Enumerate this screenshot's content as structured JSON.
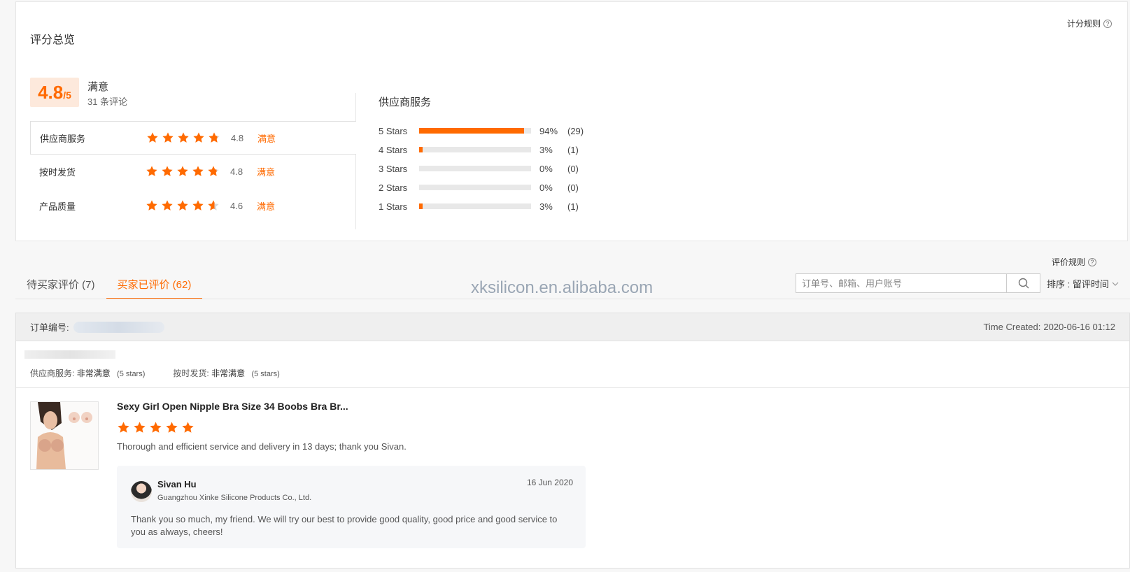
{
  "summary": {
    "title": "评分总览",
    "rules_link": "计分规则",
    "score": "4.8",
    "score_max": "/5",
    "score_label": "满意",
    "review_count": "31 条评论",
    "ratings": [
      {
        "name": "供应商服务",
        "score": "4.8",
        "grade": "满意",
        "stars_value": 4.8
      },
      {
        "name": "按时发货",
        "score": "4.8",
        "grade": "满意",
        "stars_value": 4.8
      },
      {
        "name": "产品质量",
        "score": "4.6",
        "grade": "满意",
        "stars_value": 4.6
      }
    ],
    "distribution_title": "供应商服务",
    "distribution": [
      {
        "label": "5 Stars",
        "pct": "94%",
        "count": "(29)",
        "value": 0.94
      },
      {
        "label": "4 Stars",
        "pct": "3%",
        "count": "(1)",
        "value": 0.03
      },
      {
        "label": "3 Stars",
        "pct": "0%",
        "count": "(0)",
        "value": 0
      },
      {
        "label": "2 Stars",
        "pct": "0%",
        "count": "(0)",
        "value": 0
      },
      {
        "label": "1 Stars",
        "pct": "3%",
        "count": "(1)",
        "value": 0.03
      }
    ]
  },
  "tabs": [
    {
      "label": "待买家评价 (7)"
    },
    {
      "label": "买家已评价 (62)"
    }
  ],
  "watermark": "xksilicon.en.alibaba.com",
  "review_rules": "评价规则",
  "search": {
    "placeholder": "订单号、邮箱、用户账号"
  },
  "sort": {
    "label": "排序 : 留评时间"
  },
  "review": {
    "order_label": "订单编号:",
    "time_label": "Time Created:",
    "time_value": "2020-06-16 01:12",
    "service_label": "供应商服务:",
    "service_value": "非常满意",
    "service_stars": "(5 stars)",
    "delivery_label": "按时发货:",
    "delivery_value": "非常满意",
    "delivery_stars": "(5 stars)",
    "product_title": "Sexy Girl Open Nipple Bra Size 34 Boobs Bra Br...",
    "product_rating": 5,
    "text": "Thorough and efficient service and delivery in 13 days; thank you Sivan.",
    "reply": {
      "name": "Sivan Hu",
      "company": "Guangzhou Xinke Silicone Products Co., Ltd.",
      "date": "16 Jun 2020",
      "text": "Thank you so much, my friend. We will try our best to provide good quality, good price and good service to you as always, cheers!"
    }
  },
  "colors": {
    "accent": "#ff6a00",
    "bar_bg": "#e8e8e8"
  }
}
